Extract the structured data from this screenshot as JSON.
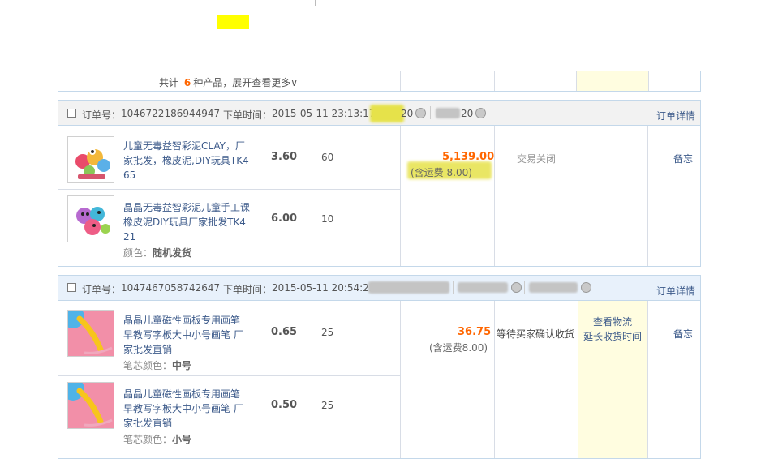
{
  "summary": {
    "prefix": "共计",
    "count": "6",
    "suffix": "种产品，展开查看更多∨"
  },
  "orders": [
    {
      "order_label": "订单号：",
      "order_no": "1046722186944947",
      "time_label": "下单时间：",
      "time": "2015-05-11 23:13:17",
      "seller_frag1": "20",
      "seller_frag2": "20",
      "detail_link": "订单详情",
      "total": "5,139.00",
      "shipping": "(含运费 8.00)",
      "status": "交易关闭",
      "memo": "备忘",
      "items": [
        {
          "title_lines": [
            "儿童无毒益智彩泥CLAY，厂",
            "家批发，橡皮泥,DIY玩具TK4",
            "65"
          ],
          "price": "3.60",
          "qty": "60",
          "spec_label": "",
          "spec_value": ""
        },
        {
          "title_lines": [
            "晶晶无毒益智彩泥儿童手工课",
            "橡皮泥DIY玩具厂家批发TK4",
            "21"
          ],
          "price": "6.00",
          "qty": "10",
          "spec_label": "颜色：",
          "spec_value": "随机发货"
        }
      ]
    },
    {
      "order_label": "订单号：",
      "order_no": "1047467058742647",
      "time_label": "下单时间：",
      "time": "2015-05-11 20:54:22",
      "detail_link": "订单详情",
      "total": "36.75",
      "shipping": "(含运费8.00)",
      "status": "等待买家确认收货",
      "action1": "查看物流",
      "action2": "延长收货时间",
      "memo": "备忘",
      "items": [
        {
          "title_lines": [
            "晶晶儿童磁性画板专用画笔",
            "早教写字板大中小号画笔 厂",
            "家批发直销"
          ],
          "price": "0.65",
          "qty": "25",
          "spec_label": "笔芯颜色：",
          "spec_value": "中号"
        },
        {
          "title_lines": [
            "晶晶儿童磁性画板专用画笔",
            "早教写字板大中小号画笔 厂",
            "家批发直销"
          ],
          "price": "0.50",
          "qty": "25",
          "spec_label": "笔芯颜色：",
          "spec_value": "小号"
        }
      ]
    }
  ],
  "colors": {
    "accent_orange": "#ff6600",
    "link_blue": "#3c5a8a",
    "header_gray": "#f2f2f2",
    "header_blue": "#e8f1fb",
    "highlight_yellow": "#fffde0"
  }
}
